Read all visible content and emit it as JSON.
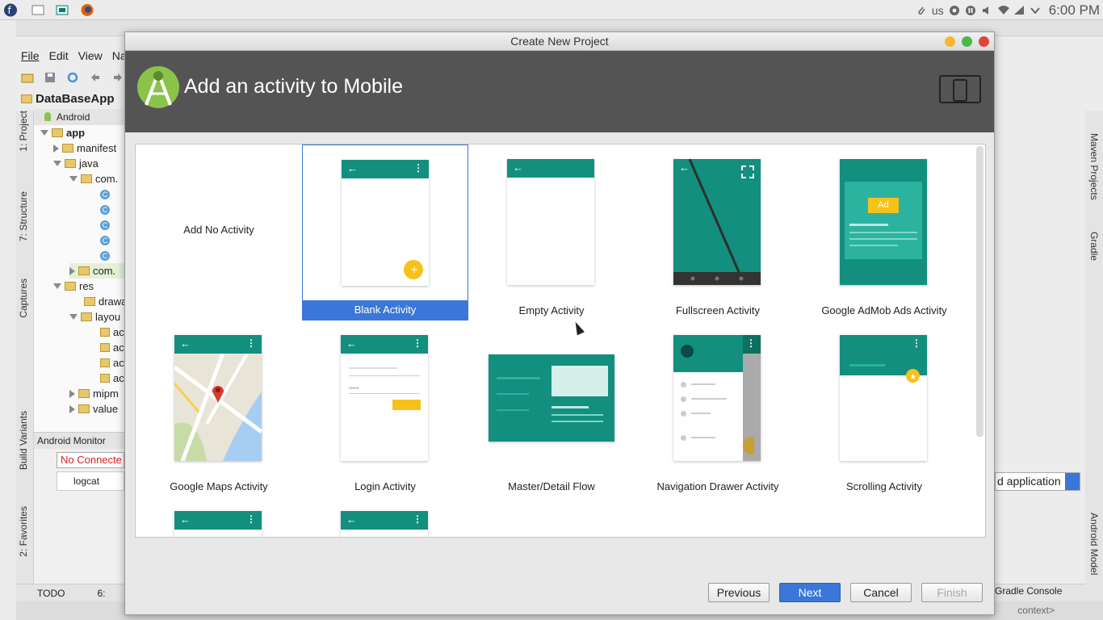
{
  "system": {
    "keyboard_layout": "us",
    "clock": "6:00 PM"
  },
  "ide": {
    "menu": [
      "File",
      "Edit",
      "View",
      "Na"
    ],
    "project_name": "DataBaseApp",
    "view_selector": "Android",
    "tree": [
      {
        "label": "app",
        "bold": true
      },
      {
        "label": "manifest"
      },
      {
        "label": "java"
      },
      {
        "label": "com."
      },
      {
        "label": "com."
      },
      {
        "label": "res"
      },
      {
        "label": "drawa"
      },
      {
        "label": "layou"
      },
      {
        "label": "ac"
      },
      {
        "label": "ac"
      },
      {
        "label": "ac"
      },
      {
        "label": "ac"
      },
      {
        "label": "mipm"
      },
      {
        "label": "value"
      }
    ],
    "left_tabs": {
      "project": "1: Project",
      "structure": "7: Structure",
      "captures": "Captures",
      "build_variants": "Build Variants",
      "favorites": "2: Favorites"
    },
    "right_tabs": {
      "maven": "Maven Projects",
      "gradle": "Gradle",
      "android_model": "Android Model"
    },
    "android_monitor": "Android Monitor",
    "no_connected": "No Connecte",
    "logcat_tab": "logcat",
    "todo_tab": "TODO",
    "run_tab": "6:",
    "run_config": "d application",
    "gradle_console": "Gradle Console",
    "context_hint": "context>"
  },
  "dialog": {
    "window_title": "Create New Project",
    "header_title": "Add an activity to Mobile",
    "tiles": [
      {
        "label": "Add No Activity",
        "selected": false
      },
      {
        "label": "Blank Activity",
        "selected": true
      },
      {
        "label": "Empty Activity",
        "selected": false
      },
      {
        "label": "Fullscreen Activity",
        "selected": false
      },
      {
        "label": "Google AdMob Ads Activity",
        "selected": false
      },
      {
        "label": "Google Maps Activity",
        "selected": false
      },
      {
        "label": "Login Activity",
        "selected": false
      },
      {
        "label": "Master/Detail Flow",
        "selected": false
      },
      {
        "label": "Navigation Drawer Activity",
        "selected": false
      },
      {
        "label": "Scrolling Activity",
        "selected": false
      }
    ],
    "ad_badge": "Ad",
    "buttons": {
      "previous": "Previous",
      "next": "Next",
      "cancel": "Cancel",
      "finish": "Finish"
    }
  },
  "colors": {
    "template_teal": "#138f7f",
    "selection_blue": "#3a77d8",
    "fab_yellow": "#f6c21a",
    "header_gray": "#545454"
  }
}
